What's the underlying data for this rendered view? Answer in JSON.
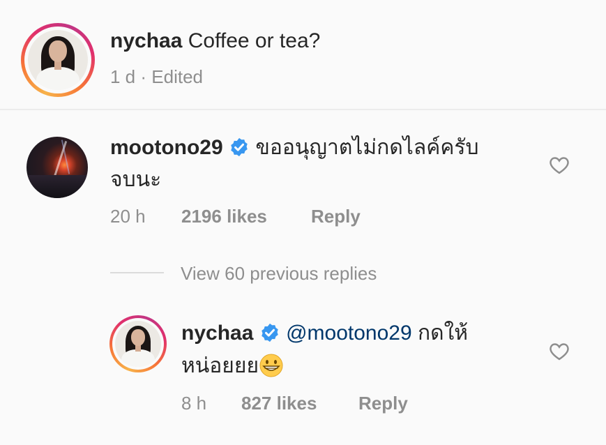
{
  "caption": {
    "username": "nychaa",
    "text": "Coffee or tea?",
    "time": "1 d",
    "separator": "·",
    "edited": "Edited"
  },
  "comment": {
    "username": "mootono29",
    "verified": true,
    "text_line1": "ขออนุญาตไม่กดไลค์ครับ",
    "text_line2": "จบนะ",
    "time": "20 h",
    "likes": "2196 likes",
    "reply_label": "Reply"
  },
  "view_replies": {
    "label": "View 60 previous replies"
  },
  "reply": {
    "username": "nychaa",
    "verified": true,
    "mention": "@mootono29",
    "text_line1_rest": "กดให้",
    "text_line2": "หน่อยยย",
    "emoji": "grinning-face",
    "time": "8 h",
    "likes": "827 likes",
    "reply_label": "Reply"
  },
  "colors": {
    "background": "#fafafa",
    "text": "#262626",
    "secondary": "#8e8e8e",
    "verified": "#3897f0",
    "mention": "#00376b"
  }
}
